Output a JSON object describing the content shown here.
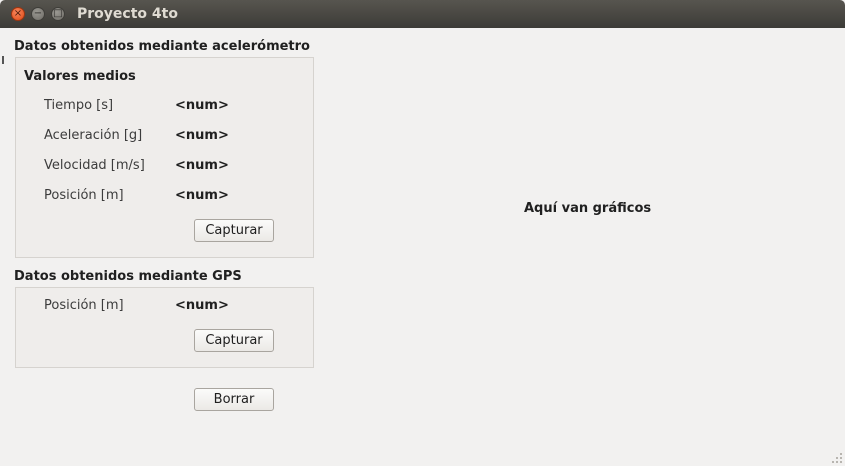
{
  "window": {
    "title": "Proyecto 4to"
  },
  "accelerometer": {
    "section_title": "Datos obtenidos mediante acelerómetro",
    "group_title": "Valores medios",
    "rows": [
      {
        "label": "Tiempo [s]",
        "value": "<num>"
      },
      {
        "label": "Aceleración [g]",
        "value": "<num>"
      },
      {
        "label": "Velocidad [m/s]",
        "value": "<num>"
      },
      {
        "label": "Posición [m]",
        "value": "<num>"
      }
    ],
    "capture_label": "Capturar"
  },
  "gps": {
    "section_title": "Datos obtenidos mediante GPS",
    "rows": [
      {
        "label": "Posición [m]",
        "value": "<num>"
      }
    ],
    "capture_label": "Capturar"
  },
  "clear_label": "Borrar",
  "charts_placeholder": "Aquí van gráficos"
}
